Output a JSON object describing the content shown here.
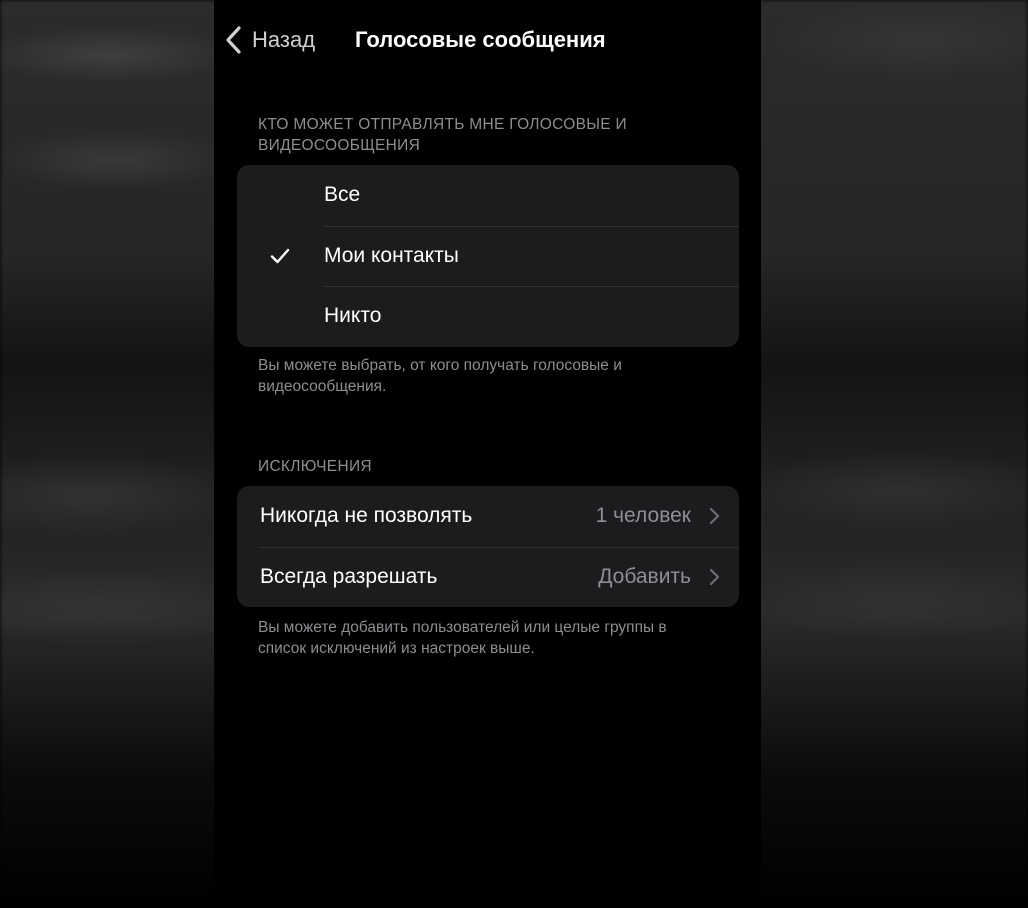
{
  "navbar": {
    "back_label": "Назад",
    "title": "Голосовые сообщения"
  },
  "who_section": {
    "header": "КТО МОЖЕТ ОТПРАВЛЯТЬ МНЕ ГОЛОСОВЫЕ И ВИДЕОСООБЩЕНИЯ",
    "options": [
      {
        "label": "Все",
        "selected": false
      },
      {
        "label": "Мои контакты",
        "selected": true
      },
      {
        "label": "Никто",
        "selected": false
      }
    ],
    "footer": "Вы можете выбрать, от кого получать голосовые и видеосообщения."
  },
  "exceptions_section": {
    "header": "ИСКЛЮЧЕНИЯ",
    "rows": [
      {
        "label": "Никогда не позволять",
        "value": "1 человек"
      },
      {
        "label": "Всегда разрешать",
        "value": "Добавить"
      }
    ],
    "footer": "Вы можете добавить пользователей или целые группы в список исключений из настроек выше."
  },
  "colors": {
    "background": "#000000",
    "cell": "#1c1c1e",
    "secondary_text": "#8d8d92",
    "primary_text": "#ffffff"
  }
}
